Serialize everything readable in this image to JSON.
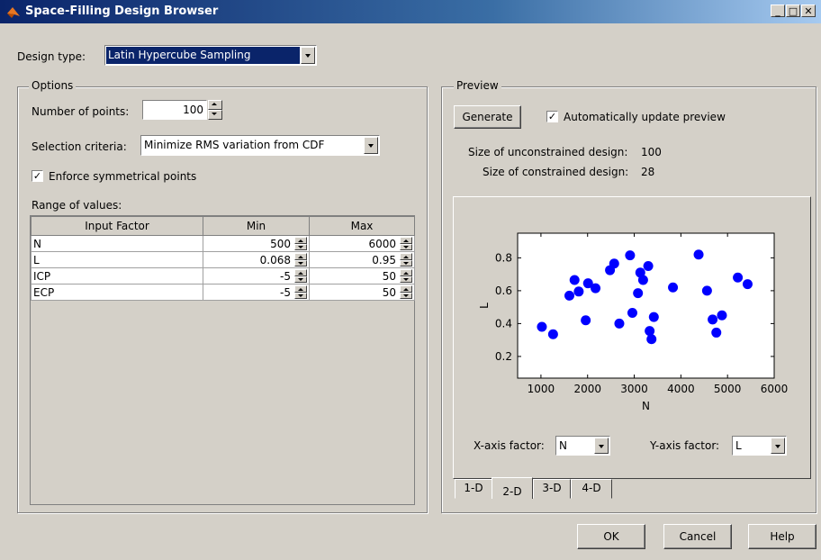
{
  "window": {
    "title": "Space-Filling Design Browser"
  },
  "design_type": {
    "label": "Design type:",
    "value": "Latin Hypercube Sampling"
  },
  "options": {
    "title": "Options",
    "num_points_label": "Number of points:",
    "num_points_value": "100",
    "selection_label": "Selection criteria:",
    "selection_value": "Minimize RMS variation from CDF",
    "symmetric_label": "Enforce symmetrical points",
    "symmetric_checked": true,
    "range_label": "Range of values:",
    "columns": [
      "Input Factor",
      "Min",
      "Max"
    ],
    "rows": [
      {
        "factor": "N",
        "min": "500",
        "max": "6000"
      },
      {
        "factor": "L",
        "min": "0.068",
        "max": "0.95"
      },
      {
        "factor": "ICP",
        "min": "-5",
        "max": "50"
      },
      {
        "factor": "ECP",
        "min": "-5",
        "max": "50"
      }
    ]
  },
  "preview": {
    "title": "Preview",
    "generate_label": "Generate",
    "auto_update_label": "Automatically update preview",
    "auto_update_checked": true,
    "unconstrained_label": "Size of unconstrained design:",
    "unconstrained_value": "100",
    "constrained_label": "Size of constrained design:",
    "constrained_value": "28",
    "x_factor_label": "X-axis factor:",
    "x_factor_value": "N",
    "y_factor_label": "Y-axis factor:",
    "y_factor_value": "L",
    "tabs": [
      "1-D",
      "2-D",
      "3-D",
      "4-D"
    ],
    "active_tab": "2-D"
  },
  "buttons": {
    "ok": "OK",
    "cancel": "Cancel",
    "help": "Help"
  },
  "colors": {
    "marker": "#0000ff",
    "titlebar": "#0a246a",
    "face": "#d4d0c8"
  },
  "chart_data": {
    "type": "scatter",
    "xlabel": "N",
    "ylabel": "L",
    "xlim": [
      500,
      6000
    ],
    "ylim": [
      0.068,
      0.95
    ],
    "xticks": [
      1000,
      2000,
      3000,
      4000,
      5000,
      6000
    ],
    "yticks": [
      0.2,
      0.4,
      0.6,
      0.8
    ],
    "grid": false,
    "points": [
      [
        1020,
        0.38
      ],
      [
        1260,
        0.335
      ],
      [
        1610,
        0.57
      ],
      [
        1720,
        0.665
      ],
      [
        1810,
        0.595
      ],
      [
        1960,
        0.42
      ],
      [
        2010,
        0.645
      ],
      [
        2170,
        0.615
      ],
      [
        2480,
        0.725
      ],
      [
        2570,
        0.765
      ],
      [
        2680,
        0.4
      ],
      [
        2910,
        0.815
      ],
      [
        2960,
        0.465
      ],
      [
        3080,
        0.585
      ],
      [
        3130,
        0.71
      ],
      [
        3190,
        0.665
      ],
      [
        3300,
        0.75
      ],
      [
        3330,
        0.355
      ],
      [
        3370,
        0.305
      ],
      [
        3420,
        0.44
      ],
      [
        3830,
        0.62
      ],
      [
        4380,
        0.82
      ],
      [
        4560,
        0.6
      ],
      [
        4680,
        0.425
      ],
      [
        4760,
        0.345
      ],
      [
        4880,
        0.45
      ],
      [
        5220,
        0.68
      ],
      [
        5430,
        0.64
      ]
    ]
  }
}
